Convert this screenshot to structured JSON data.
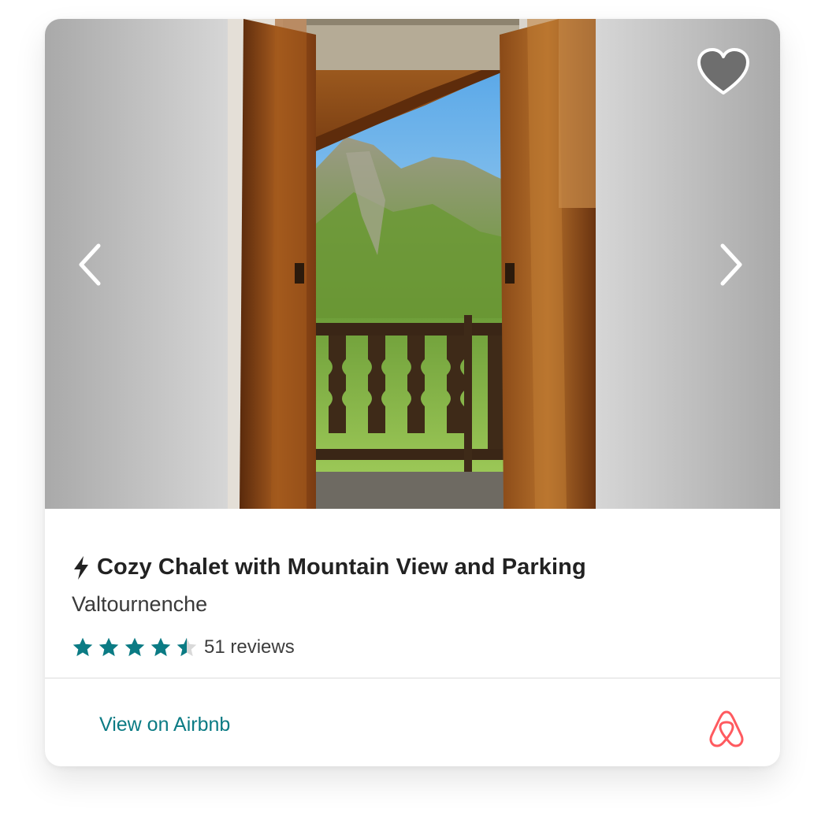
{
  "listing": {
    "title": "Cozy Chalet with Mountain View and Parking",
    "location": "Valtournenche",
    "rating_stars": 4.5,
    "reviews_label": "51 reviews"
  },
  "gallery": {
    "prev_icon": "chevron-left-icon",
    "next_icon": "chevron-right-icon",
    "favorite_icon": "heart-icon"
  },
  "footer": {
    "link_label": "View on Airbnb",
    "logo": "airbnb-logo"
  },
  "colors": {
    "accent": "#0b7b84",
    "star": "#0b7b84",
    "brand": "#ff5a5f",
    "title": "#222222"
  }
}
